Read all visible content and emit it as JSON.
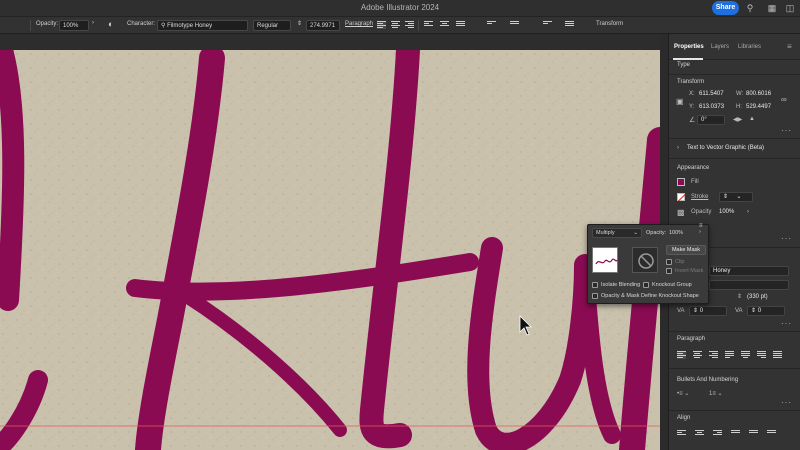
{
  "app": {
    "title": "Adobe Illustrator 2024",
    "share_label": "Share"
  },
  "control_bar": {
    "opacity_label": "Opacity:",
    "opacity_value": "100%",
    "character_label": "Character:",
    "font_family": "Filmotype Honey",
    "font_style": "Regular",
    "font_size": "274.9971",
    "paragraph_label": "Paragraph",
    "transform_label": "Transform"
  },
  "panel": {
    "tabs": [
      "Properties",
      "Layers",
      "Libraries"
    ],
    "type_label": "Type",
    "transform_label": "Transform",
    "x_label": "X:",
    "x_value": "611.5407",
    "y_label": "Y:",
    "y_value": "613.0373",
    "w_label": "W:",
    "w_value": "800.6016",
    "h_label": "H:",
    "h_value": "529.4497",
    "angle_value": "0°",
    "text_to_vector": "Text to Vector Graphic (Beta)",
    "appearance_label": "Appearance",
    "fill_label": "Fill",
    "stroke_label": "Stroke",
    "opacity_label": "Opacity",
    "opacity_value": "100%",
    "font_partial": "Honey",
    "leading_value": "(330 pt)",
    "tracking_value": "0",
    "kerning_value": "0",
    "paragraph_label": "Paragraph",
    "bullets_label": "Bullets And Numbering",
    "align_label": "Align"
  },
  "transparency_popup": {
    "blend_mode": "Multiply",
    "opacity_label": "Opacity:",
    "opacity_value": "100%",
    "make_mask": "Make Mask",
    "clip": "Clip",
    "invert_mask": "Invert Mask",
    "isolate_blending": "Isolate Blending",
    "knockout_group": "Knockout Group",
    "opacity_mask_shape": "Opacity & Mask Define Knockout Shape"
  },
  "colors": {
    "accent": "#1e6fe0",
    "lettering": "#8b0b52",
    "paper": "#c9c1ac"
  }
}
